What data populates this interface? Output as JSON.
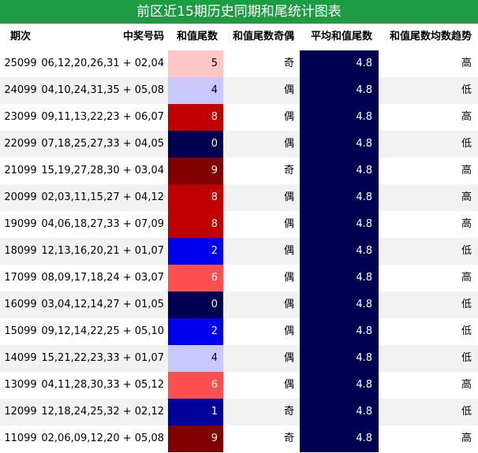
{
  "title": "前区近15期历史同期和尾统计图表",
  "headers": {
    "period": "期次",
    "numbers": "中奖号码",
    "tail": "和值尾数",
    "parity": "和值尾数奇偶",
    "avg": "平均和值尾数",
    "trend": "和值尾数均数趋势"
  },
  "colors": {
    "title_bg": "#1e9c44",
    "avg_bg": "#000050",
    "tail_0": "#000050",
    "tail_1": "#00009a",
    "tail_2": "#0000ee",
    "tail_4": "#c8c8ff",
    "tail_5": "#ffc8c8",
    "tail_6": "#ff5050",
    "tail_8": "#c00000",
    "tail_9": "#800000"
  },
  "rows": [
    {
      "period": "25099",
      "numbers": "06,12,20,26,31 + 02,04",
      "tail": "5",
      "parity": "奇",
      "avg": "4.8",
      "trend": "高"
    },
    {
      "period": "24099",
      "numbers": "04,10,24,31,35 + 05,08",
      "tail": "4",
      "parity": "偶",
      "avg": "4.8",
      "trend": "低"
    },
    {
      "period": "23099",
      "numbers": "09,11,13,22,23 + 06,07",
      "tail": "8",
      "parity": "偶",
      "avg": "4.8",
      "trend": "高"
    },
    {
      "period": "22099",
      "numbers": "07,18,25,27,33 + 04,05",
      "tail": "0",
      "parity": "偶",
      "avg": "4.8",
      "trend": "低"
    },
    {
      "period": "21099",
      "numbers": "15,19,27,28,30 + 03,04",
      "tail": "9",
      "parity": "奇",
      "avg": "4.8",
      "trend": "高"
    },
    {
      "period": "20099",
      "numbers": "02,03,11,15,27 + 04,12",
      "tail": "8",
      "parity": "偶",
      "avg": "4.8",
      "trend": "高"
    },
    {
      "period": "19099",
      "numbers": "04,06,18,27,33 + 07,09",
      "tail": "8",
      "parity": "偶",
      "avg": "4.8",
      "trend": "高"
    },
    {
      "period": "18099",
      "numbers": "12,13,16,20,21 + 01,07",
      "tail": "2",
      "parity": "偶",
      "avg": "4.8",
      "trend": "低"
    },
    {
      "period": "17099",
      "numbers": "08,09,17,18,24 + 03,07",
      "tail": "6",
      "parity": "偶",
      "avg": "4.8",
      "trend": "高"
    },
    {
      "period": "16099",
      "numbers": "03,04,12,14,27 + 01,05",
      "tail": "0",
      "parity": "偶",
      "avg": "4.8",
      "trend": "低"
    },
    {
      "period": "15099",
      "numbers": "09,12,14,22,25 + 05,10",
      "tail": "2",
      "parity": "偶",
      "avg": "4.8",
      "trend": "低"
    },
    {
      "period": "14099",
      "numbers": "15,21,22,23,33 + 01,07",
      "tail": "4",
      "parity": "偶",
      "avg": "4.8",
      "trend": "低"
    },
    {
      "period": "13099",
      "numbers": "04,11,28,30,33 + 05,12",
      "tail": "6",
      "parity": "偶",
      "avg": "4.8",
      "trend": "高"
    },
    {
      "period": "12099",
      "numbers": "12,18,24,25,32 + 02,12",
      "tail": "1",
      "parity": "奇",
      "avg": "4.8",
      "trend": "低"
    },
    {
      "period": "11099",
      "numbers": "02,06,09,12,20 + 05,08",
      "tail": "9",
      "parity": "奇",
      "avg": "4.8",
      "trend": "高"
    }
  ]
}
